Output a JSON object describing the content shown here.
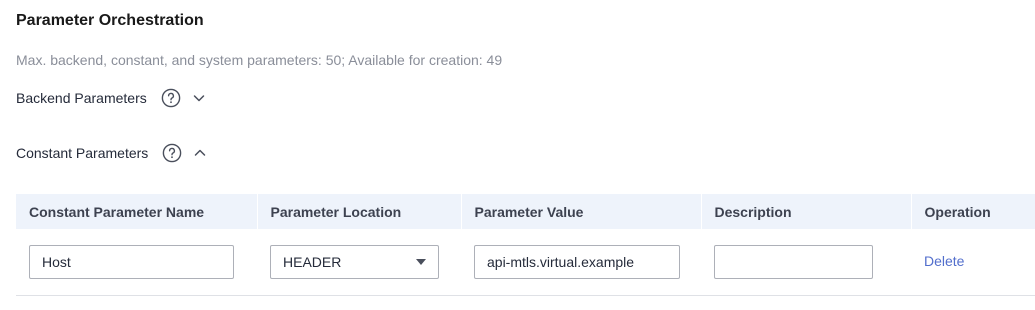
{
  "title": "Parameter Orchestration",
  "hint": "Max. backend, constant, and system parameters: 50; Available for creation: 49",
  "sections": {
    "backend": {
      "label": "Backend Parameters",
      "expanded": false
    },
    "constant": {
      "label": "Constant Parameters",
      "expanded": true
    }
  },
  "table": {
    "columns": {
      "name": "Constant Parameter Name",
      "location": "Parameter Location",
      "value": "Parameter Value",
      "description": "Description",
      "operation": "Operation"
    },
    "rows": [
      {
        "name": "Host",
        "location": "HEADER",
        "value": "api-mtls.virtual.example",
        "description": "",
        "operation": "Delete"
      }
    ]
  },
  "colors": {
    "accent": "#526ecc",
    "header_bg": "#eef3fb",
    "hint_text": "#8a8e99"
  },
  "icons": {
    "help": "question-circle-icon",
    "collapsed": "chevron-down-icon",
    "expanded": "chevron-up-icon",
    "dropdown": "caret-down-icon"
  }
}
